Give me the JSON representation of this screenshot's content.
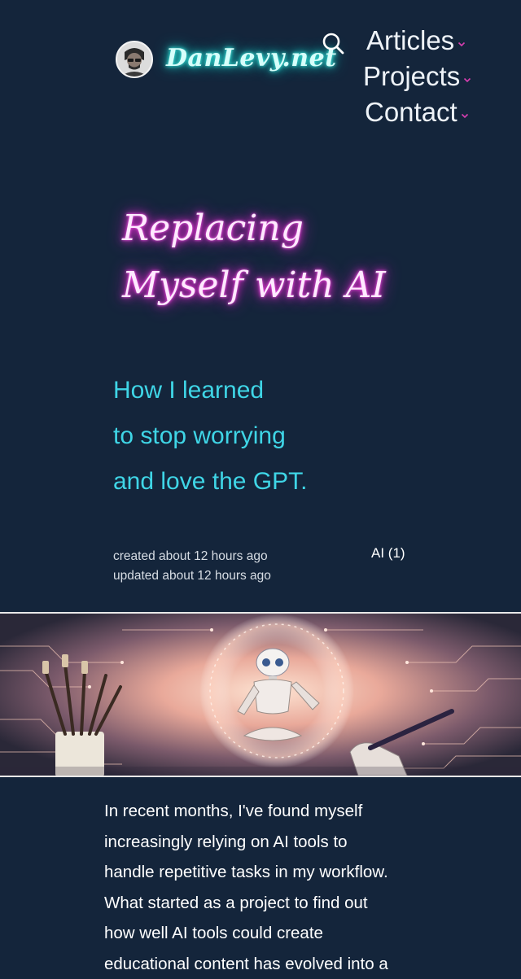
{
  "header": {
    "site_name": "DanLevy.net",
    "avatar_icon": "person-avatar-icon",
    "search_icon": "search-icon",
    "nav": [
      {
        "label": "Articles"
      },
      {
        "label": "Projects"
      },
      {
        "label": "Contact"
      }
    ]
  },
  "article": {
    "title_line1": "Replacing",
    "title_line2": "Myself with AI",
    "subtitle_lines": [
      "How I learned",
      "to stop worrying",
      "and love the GPT."
    ],
    "created": "created about 12 hours ago",
    "updated": "updated about 12 hours ago",
    "tag": "AI (1)",
    "body_lines": [
      "In recent months, I've found myself",
      "increasingly relying on AI tools to",
      "handle repetitive tasks in my workflow.",
      "What started as a project to find out",
      "how well AI tools could create",
      "educational content has evolved into a"
    ]
  },
  "colors": {
    "background": "#14253b",
    "site_name_glow": "#1fd6d0",
    "title_glow": "#ff2ee0",
    "subtitle": "#3fd5e6",
    "nav_caret": "#d63fb0"
  }
}
